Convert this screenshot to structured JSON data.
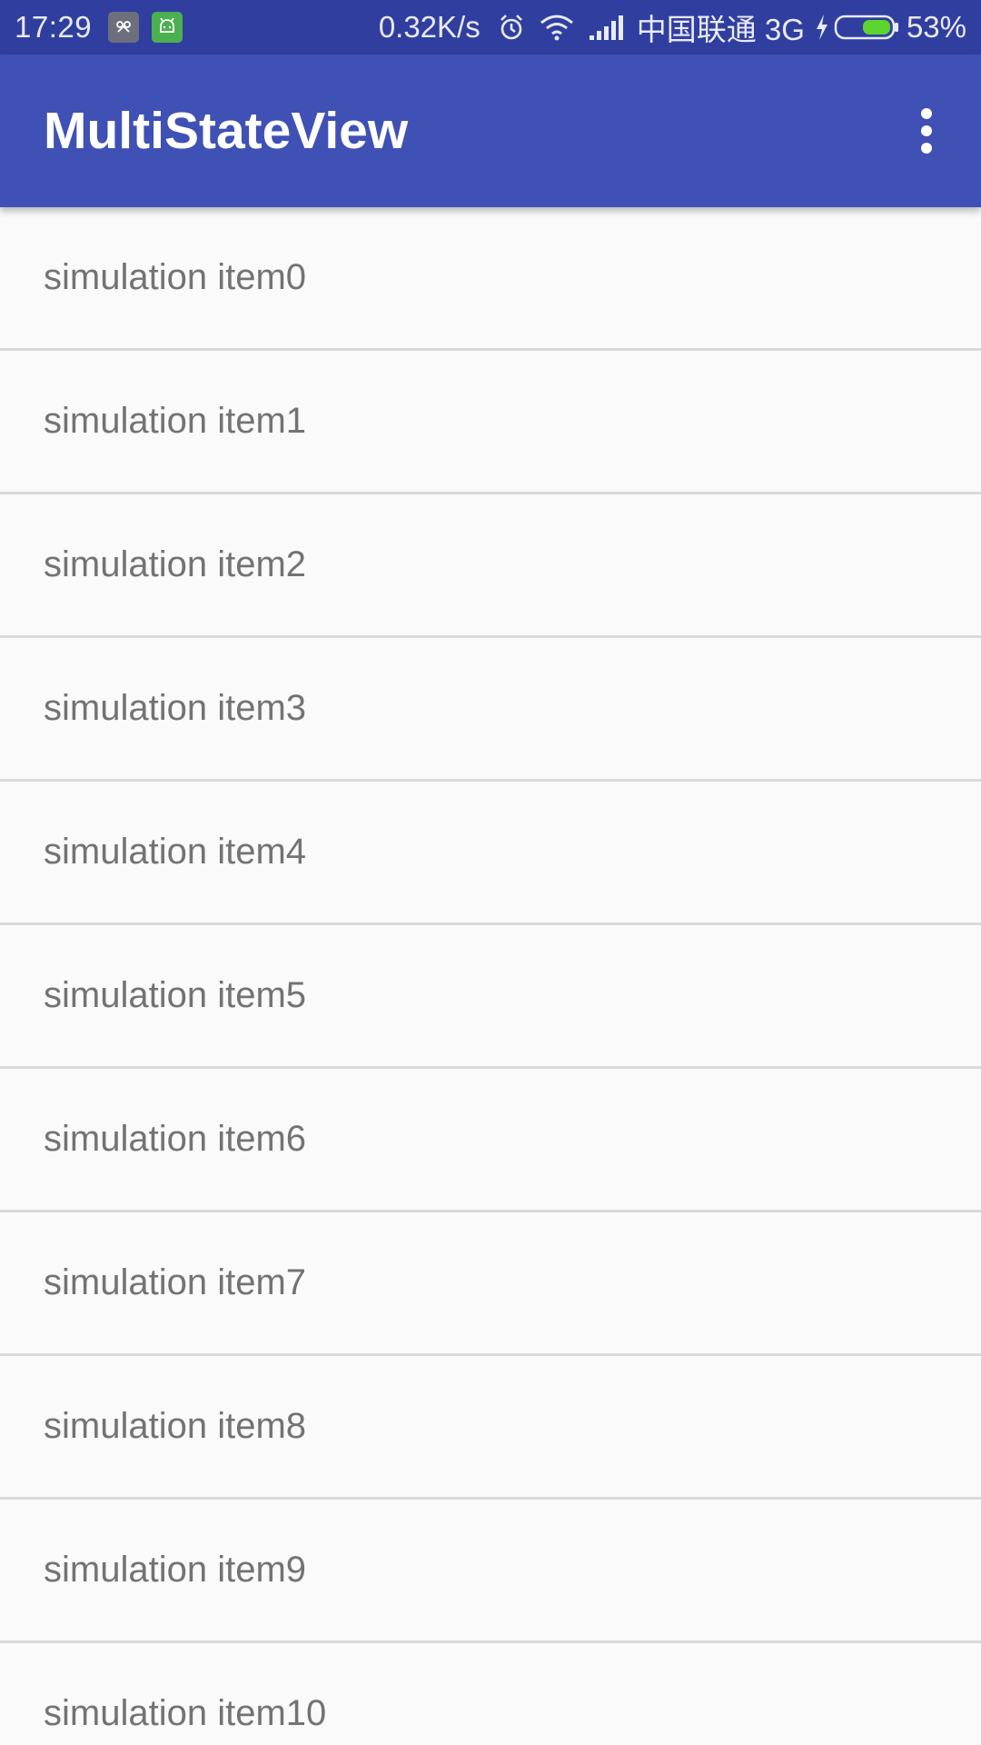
{
  "status_bar": {
    "time": "17:29",
    "net_speed": "0.32K/s",
    "carrier": "中国联通 3G",
    "battery_percent": "53%",
    "battery_level": 0.53,
    "battery_color": "#5cd62e",
    "icons": [
      "notification-app-icon",
      "android-icon",
      "alarm-icon",
      "wifi-icon",
      "signal-icon",
      "charging-icon",
      "battery-icon"
    ]
  },
  "app_bar": {
    "title": "MultiStateView",
    "color": "#3f51b5",
    "overflow_icon": "more-vert-icon"
  },
  "list": {
    "items": [
      {
        "label": "simulation item0"
      },
      {
        "label": "simulation item1"
      },
      {
        "label": "simulation item2"
      },
      {
        "label": "simulation item3"
      },
      {
        "label": "simulation item4"
      },
      {
        "label": "simulation item5"
      },
      {
        "label": "simulation item6"
      },
      {
        "label": "simulation item7"
      },
      {
        "label": "simulation item8"
      },
      {
        "label": "simulation item9"
      },
      {
        "label": "simulation item10"
      }
    ]
  }
}
